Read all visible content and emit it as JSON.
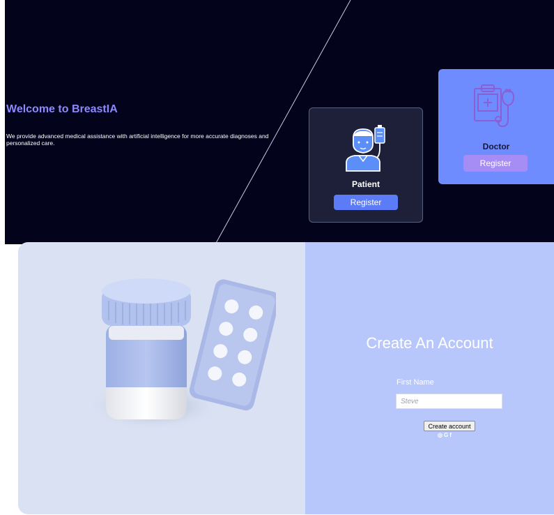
{
  "hero": {
    "title": "Welcome to BreastIA",
    "description": "We provide advanced medical assistance with artificial intelligence for more accurate diagnoses and personalized care."
  },
  "roles": [
    {
      "name": "Patient",
      "button": "Register",
      "icon": "patient-iv-icon"
    },
    {
      "name": "Doctor",
      "button": "Register",
      "icon": "clipboard-stethoscope-icon"
    }
  ],
  "signup": {
    "title": "Create An Account",
    "first_name_label": "First Name",
    "first_name_placeholder": "Steve",
    "submit_label": "Create account",
    "social_icons": [
      {
        "icon": "instagram-icon",
        "glyph": "◎"
      },
      {
        "icon": "google-icon",
        "glyph": "G"
      },
      {
        "icon": "facebook-icon",
        "glyph": "f"
      }
    ]
  },
  "colors": {
    "hero_bg": "#03031c",
    "accent": "#8c88ff",
    "patient_card": "#1d2038",
    "doctor_card": "#6f8cff",
    "register_left": "#d9e1f3",
    "register_right": "#b7c7fc"
  },
  "illustration": "medicine-bottle-and-pills-illustration"
}
